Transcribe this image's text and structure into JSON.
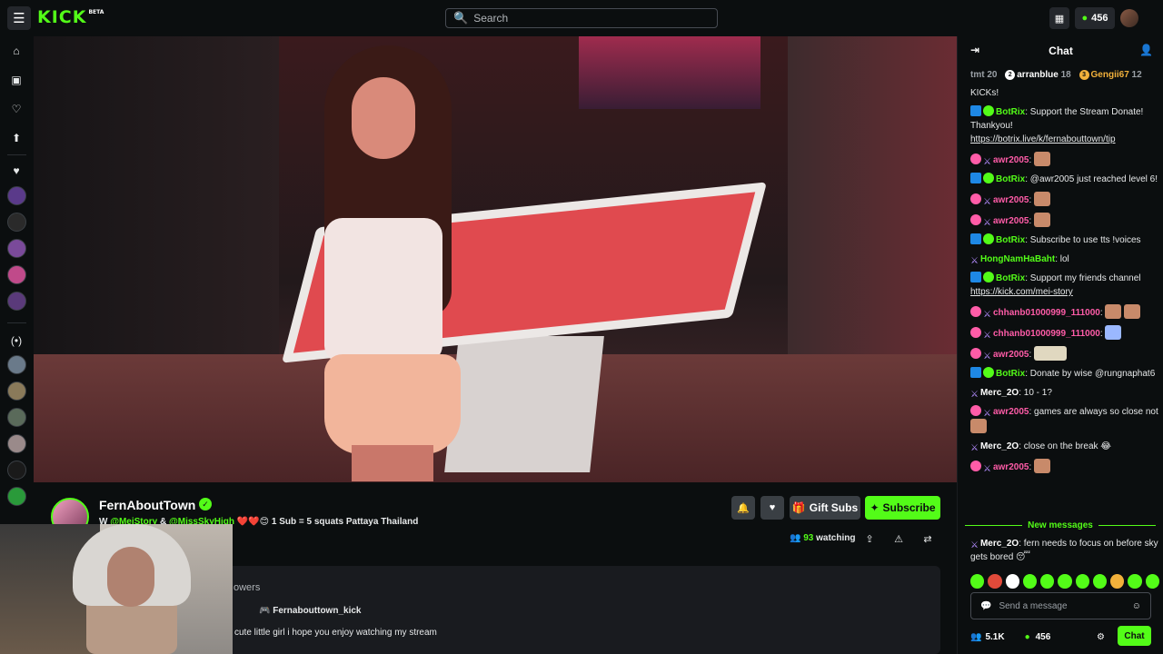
{
  "app": {
    "logo": "KICK",
    "logo_tag": "BETA"
  },
  "search": {
    "placeholder": "Search"
  },
  "topbar": {
    "kicks_count": "456"
  },
  "channel": {
    "name": "FernAboutTown",
    "title_prefix": "W ",
    "tag1": "@MeiStory",
    "title_amp": " & ",
    "tag2": "@MissSkyHigh",
    "title_rest": " ❤️❤️😊 1 Sub = 5 squats  Pattaya Thailand",
    "watching_count": "93",
    "watching_label": " watching"
  },
  "buttons": {
    "gift_subs": "Gift Subs",
    "subscribe": "Subscribe"
  },
  "about": {
    "followers_label": "owers",
    "social1": "wn",
    "social2": "Fernabouttown_kick",
    "bio": "cute little girl i hope you enjoy watching my stream"
  },
  "chat": {
    "title": "Chat",
    "leaderboard": [
      {
        "name": "tmt",
        "count": "20"
      },
      {
        "name": "arranblue",
        "count": "18"
      },
      {
        "name": "Gengii67",
        "count": "12"
      }
    ],
    "messages": [
      {
        "user": "",
        "text": "KICKs!"
      },
      {
        "user": "BotRix",
        "text": "Support the Stream Donate! Thankyou!",
        "link": "https://botrix.live/k/fernabouttown/tip"
      },
      {
        "user": "awr2005",
        "text": ""
      },
      {
        "user": "BotRix",
        "text": "@awr2005 just reached level 6!"
      },
      {
        "user": "awr2005",
        "text": ""
      },
      {
        "user": "awr2005",
        "text": ""
      },
      {
        "user": "BotRix",
        "text": "Subscribe to use tts !voices"
      },
      {
        "user": "HongNamHaBaht",
        "text": "lol"
      },
      {
        "user": "BotRix",
        "text": "Support my friends channel",
        "link": "https://kick.com/mei-story"
      },
      {
        "user": "chhanb01000999_111000",
        "text": ""
      },
      {
        "user": "chhanb01000999_111000",
        "text": ""
      },
      {
        "user": "awr2005",
        "text": ""
      },
      {
        "user": "BotRix",
        "text": "Donate by wise @rungnaphat6"
      },
      {
        "user": "Merc_2O",
        "text": "10 - 1?"
      },
      {
        "user": "awr2005",
        "text": "games are always so close not"
      },
      {
        "user": "Merc_2O",
        "text": "close on the break 😂"
      },
      {
        "user": "awr2005",
        "text": ""
      }
    ],
    "new_messages": "New messages",
    "last_message": {
      "user": "Merc_2O",
      "text": "fern needs to focus on before sky gets bored 😴"
    },
    "input_placeholder": "Send a message",
    "followers_count": "5.1K",
    "kicks_count": "456",
    "chat_button": "Chat"
  },
  "colors": {
    "accent": "#53fc18",
    "bg": "#0b0e0f"
  }
}
